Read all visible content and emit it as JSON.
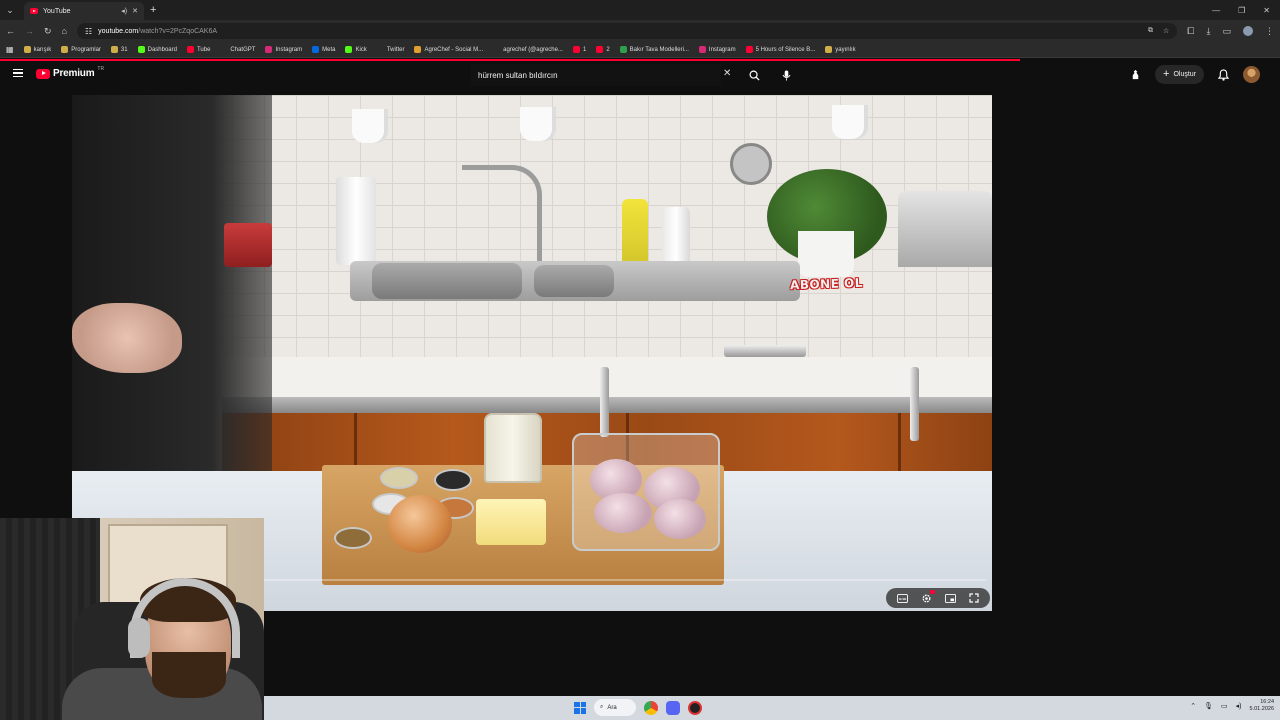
{
  "browser": {
    "tab_title": "YouTube",
    "address_host": "youtube.com",
    "address_path": "/watch?v=2PcZqoCAK6A",
    "bookmarks": [
      {
        "label": "karışık",
        "color": "#cfae49"
      },
      {
        "label": "Programlar",
        "color": "#cfae49"
      },
      {
        "label": "31",
        "color": "#cfae49"
      },
      {
        "label": "Dashboard",
        "color": "#53fc18"
      },
      {
        "label": "Tube",
        "color": "#ff0033"
      },
      {
        "label": "ChatGPT",
        "color": "#2b2b2b"
      },
      {
        "label": "Instagram",
        "color": "#d62976"
      },
      {
        "label": "Meta",
        "color": "#0668e1"
      },
      {
        "label": "Kick",
        "color": "#53fc18"
      },
      {
        "label": "Twitter",
        "color": "#2b2b2b"
      },
      {
        "label": "AgreChef - Social M...",
        "color": "#e0a030"
      },
      {
        "label": "agrechef (@agreche...",
        "color": "#2b2b2b"
      },
      {
        "label": "1",
        "color": "#ff0033"
      },
      {
        "label": "2",
        "color": "#ff0033"
      },
      {
        "label": "Bakır Tava Modelleri...",
        "color": "#2e9f4a"
      },
      {
        "label": "Instagram",
        "color": "#d62976"
      },
      {
        "label": "5 Hours of Silence B...",
        "color": "#ff0033"
      },
      {
        "label": "yayınlık",
        "color": "#cfae49"
      }
    ],
    "loading_color": "#ff0033"
  },
  "youtube": {
    "logo_text": "Premium",
    "logo_region": "TR",
    "search_value": "hürrem sultan bıldırcın",
    "create_label": "Oluştur",
    "brand_color": "#ff0033"
  },
  "video": {
    "overlay_text": "ABONE OL",
    "controls": [
      "subtitles-icon",
      "settings-icon",
      "miniplayer-icon",
      "fullscreen-icon"
    ]
  },
  "taskbar": {
    "search_label": "Ara",
    "time": "16:24",
    "date": "5.01.2026"
  }
}
